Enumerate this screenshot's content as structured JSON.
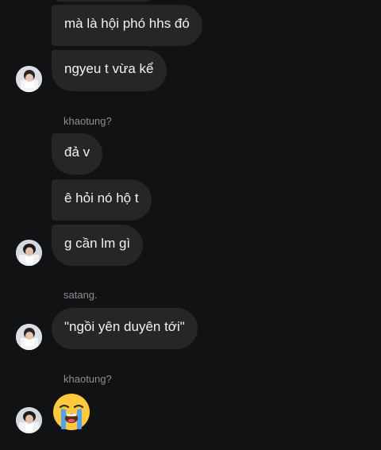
{
  "messages": [
    {
      "id": "m1",
      "text": "mà là hội phó hhs đó"
    },
    {
      "id": "m2",
      "text": "ngyeu t vừa kể"
    },
    {
      "id": "m3",
      "text": "đả v"
    },
    {
      "id": "m4",
      "text": "ê hỏi nó hộ t"
    },
    {
      "id": "m5",
      "text": "g cần lm gì"
    },
    {
      "id": "m6",
      "text": "\"ngồi yên duyên tới\""
    }
  ],
  "senders": [
    "khaotung?",
    "satang.",
    "khaotung?"
  ],
  "emoji": {
    "name": "loudly-crying-face",
    "glyph": "😭"
  },
  "colors": {
    "background": "#111214",
    "bubble": "#262629",
    "sender_text": "#8e8e93",
    "emoji_yellow": "#ffc83d",
    "emoji_tear": "#4fa3f7"
  }
}
